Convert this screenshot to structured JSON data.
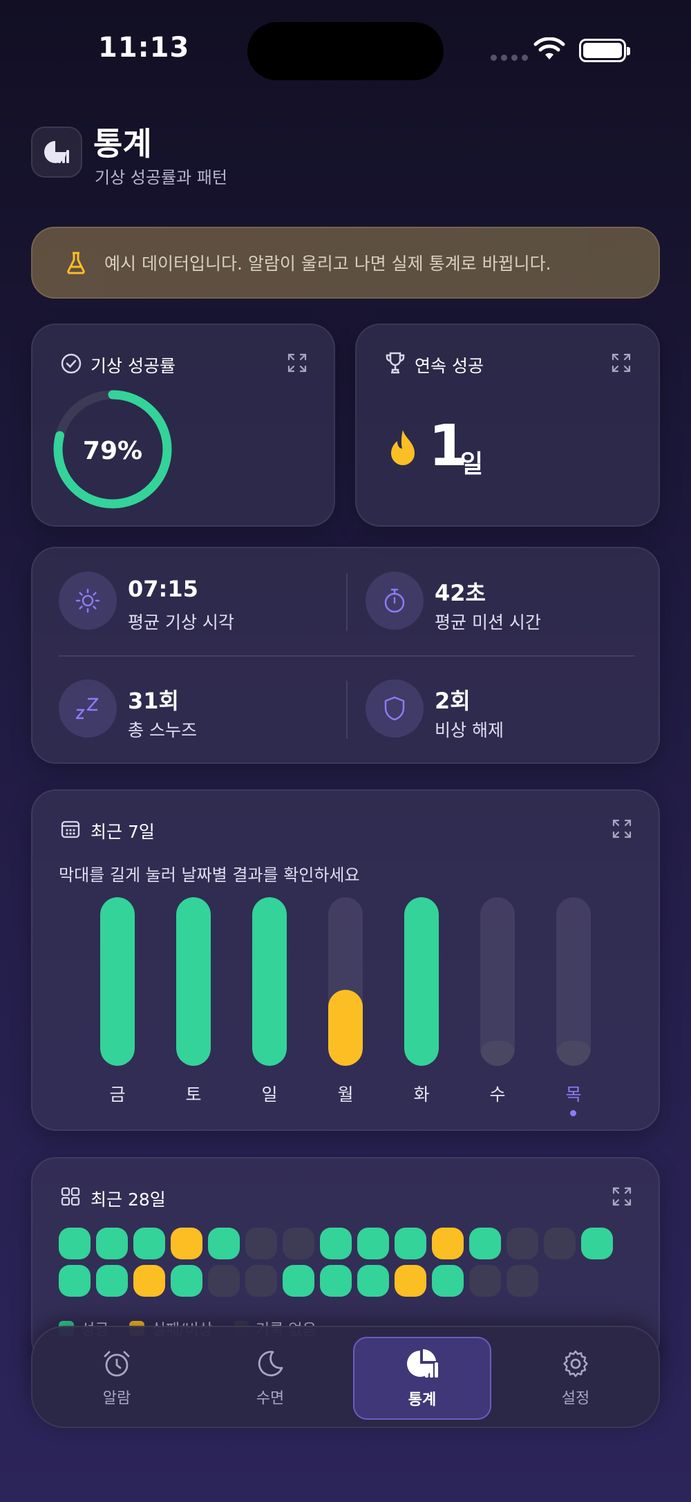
{
  "status_bar": {
    "time": "11:13"
  },
  "header": {
    "title": "통계",
    "subtitle": "기상 성공률과 패턴"
  },
  "notice": {
    "text": "예시 데이터입니다. 알람이 울리고 나면 실제 통계로 바뀝니다."
  },
  "success_rate": {
    "title": "기상 성공률",
    "value": "79%",
    "percent": 79
  },
  "streak": {
    "title": "연속 성공",
    "value": "1",
    "unit": "일"
  },
  "stats": {
    "avg_wake": {
      "value": "07:15",
      "label": "평균 기상 시각"
    },
    "avg_mission": {
      "value": "42초",
      "label": "평균 미션 시간"
    },
    "snooze": {
      "value": "31회",
      "label": "총 스누즈"
    },
    "emergency": {
      "value": "2회",
      "label": "비상 해제"
    }
  },
  "week": {
    "title": "최근 7일",
    "hint": "막대를 길게 눌러 날짜별 결과를 확인하세요",
    "chart_data": {
      "type": "bar",
      "categories": [
        "금",
        "토",
        "일",
        "월",
        "화",
        "수",
        "목"
      ],
      "values": [
        1.0,
        1.0,
        1.0,
        0.45,
        1.0,
        0.0,
        0.0
      ],
      "status": [
        "success",
        "success",
        "success",
        "fail",
        "success",
        "none",
        "none"
      ],
      "today_index": 6
    }
  },
  "month": {
    "title": "최근 28일",
    "cells": [
      "s",
      "s",
      "s",
      "f",
      "s",
      "n",
      "n",
      "s",
      "s",
      "s",
      "f",
      "s",
      "n",
      "n",
      "s",
      "s",
      "s",
      "f",
      "s",
      "n",
      "n",
      "s",
      "s",
      "s",
      "f",
      "s",
      "n",
      "n"
    ],
    "legend": {
      "success": "성공",
      "fail": "실패/비상",
      "none": "기록 없음"
    }
  },
  "colors": {
    "success": "#34d399",
    "fail": "#fbbf24",
    "none": "#3e3b55",
    "accent": "#8b7cf6"
  },
  "tabs": [
    {
      "label": "알람",
      "icon": "alarm-clock-icon"
    },
    {
      "label": "수면",
      "icon": "moon-icon"
    },
    {
      "label": "통계",
      "icon": "chart-pie-icon",
      "active": true
    },
    {
      "label": "설정",
      "icon": "gear-icon"
    }
  ]
}
